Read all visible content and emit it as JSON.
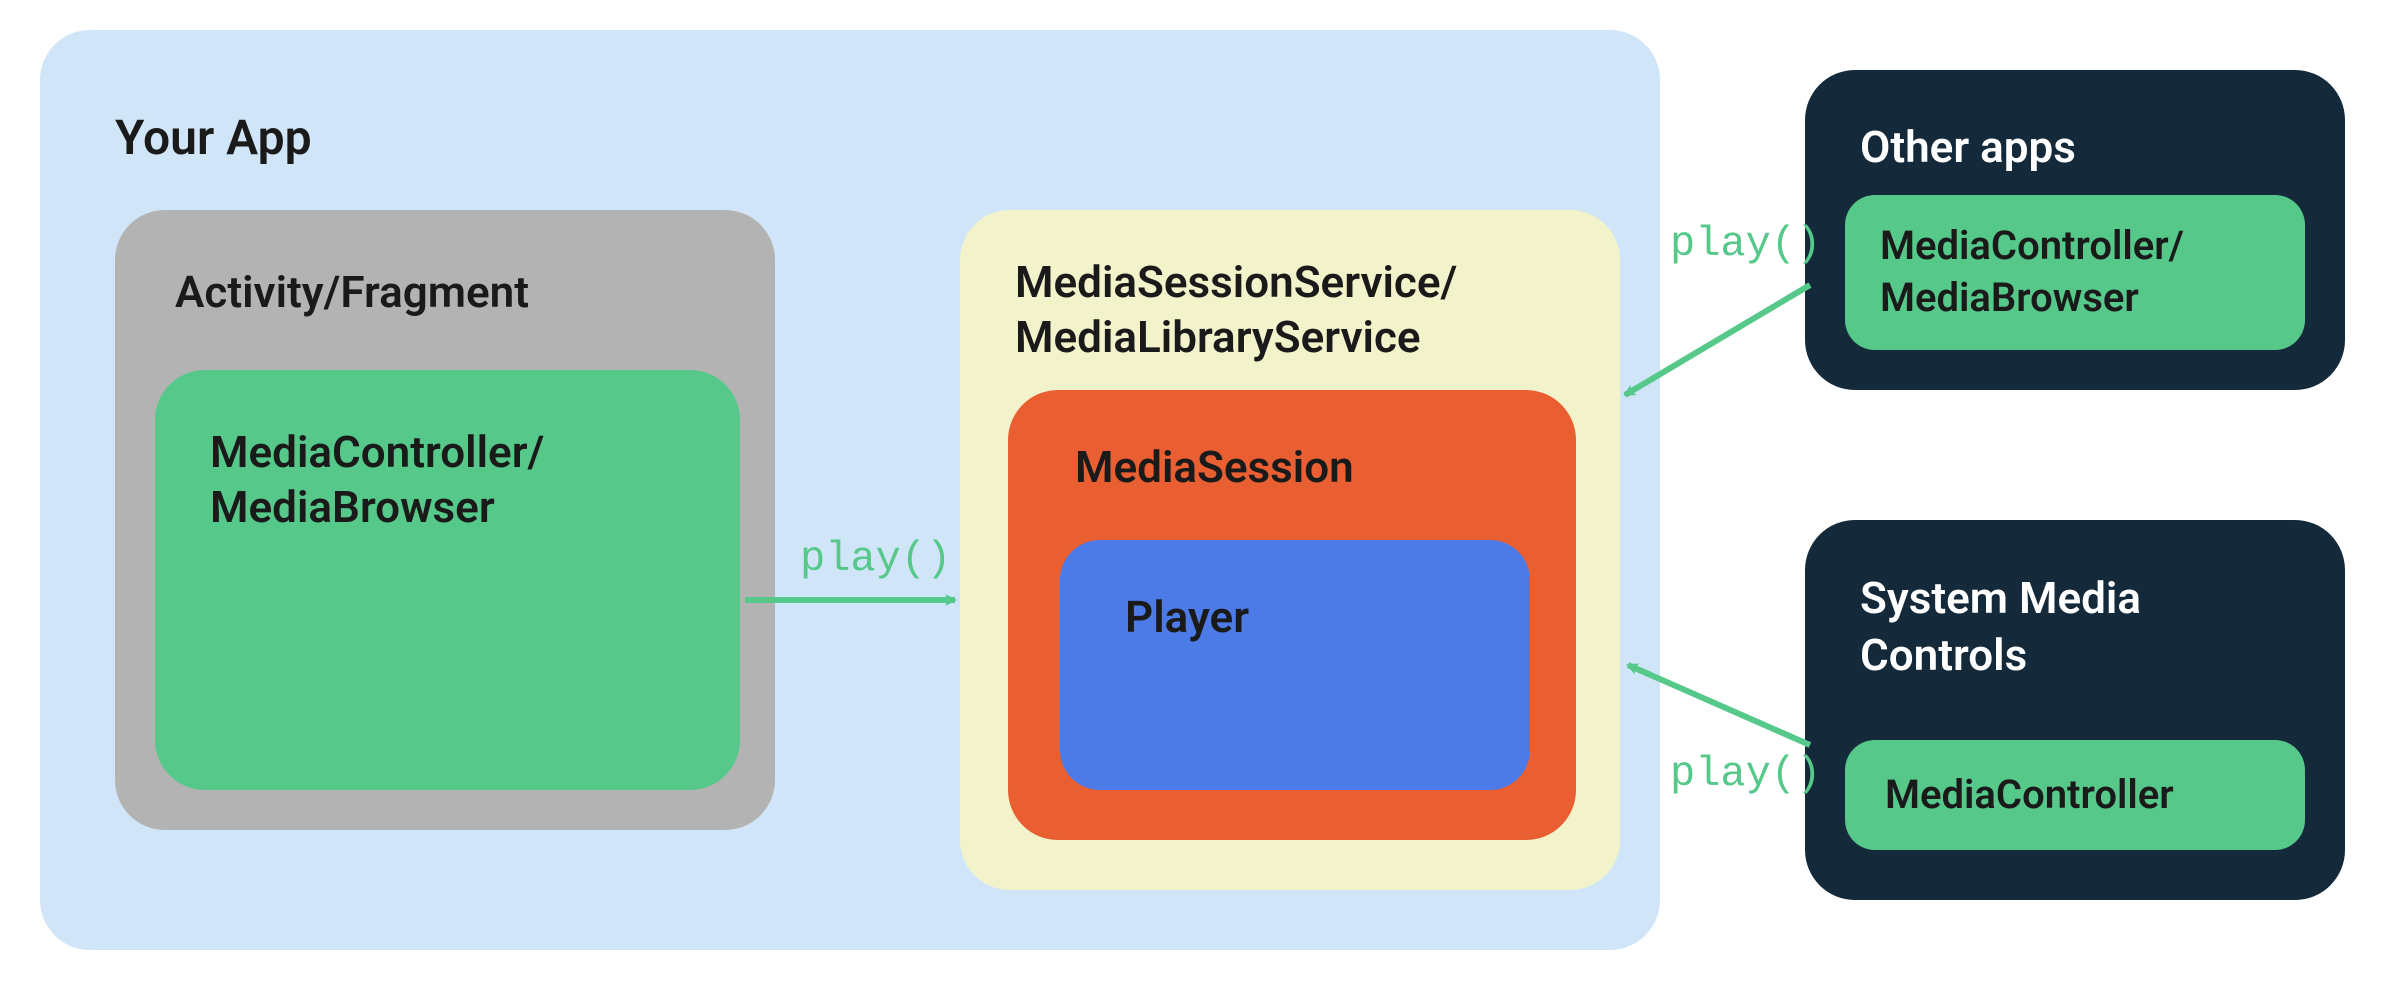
{
  "app": {
    "title": "Your App",
    "activity": {
      "title": "Activity/Fragment",
      "controller": "MediaController/\nMediaBrowser"
    },
    "service": {
      "title": "MediaSessionService/\nMediaLibraryService",
      "session": "MediaSession",
      "player": "Player"
    }
  },
  "other_apps": {
    "title": "Other apps",
    "controller": "MediaController/\nMediaBrowser"
  },
  "system_controls": {
    "title": "System Media\nControls",
    "controller": "MediaController"
  },
  "arrows": {
    "play_internal": "play()",
    "play_other": "play()",
    "play_system": "play()"
  },
  "colors": {
    "app_bg": "#D0E6F8",
    "activity_bg": "#B3B3B3",
    "green": "#55C88A",
    "service_bg": "#F3F3CB",
    "orange": "#E95F32",
    "blue": "#4C7BE8",
    "dark": "#14293A",
    "arrow": "#55C88A"
  }
}
